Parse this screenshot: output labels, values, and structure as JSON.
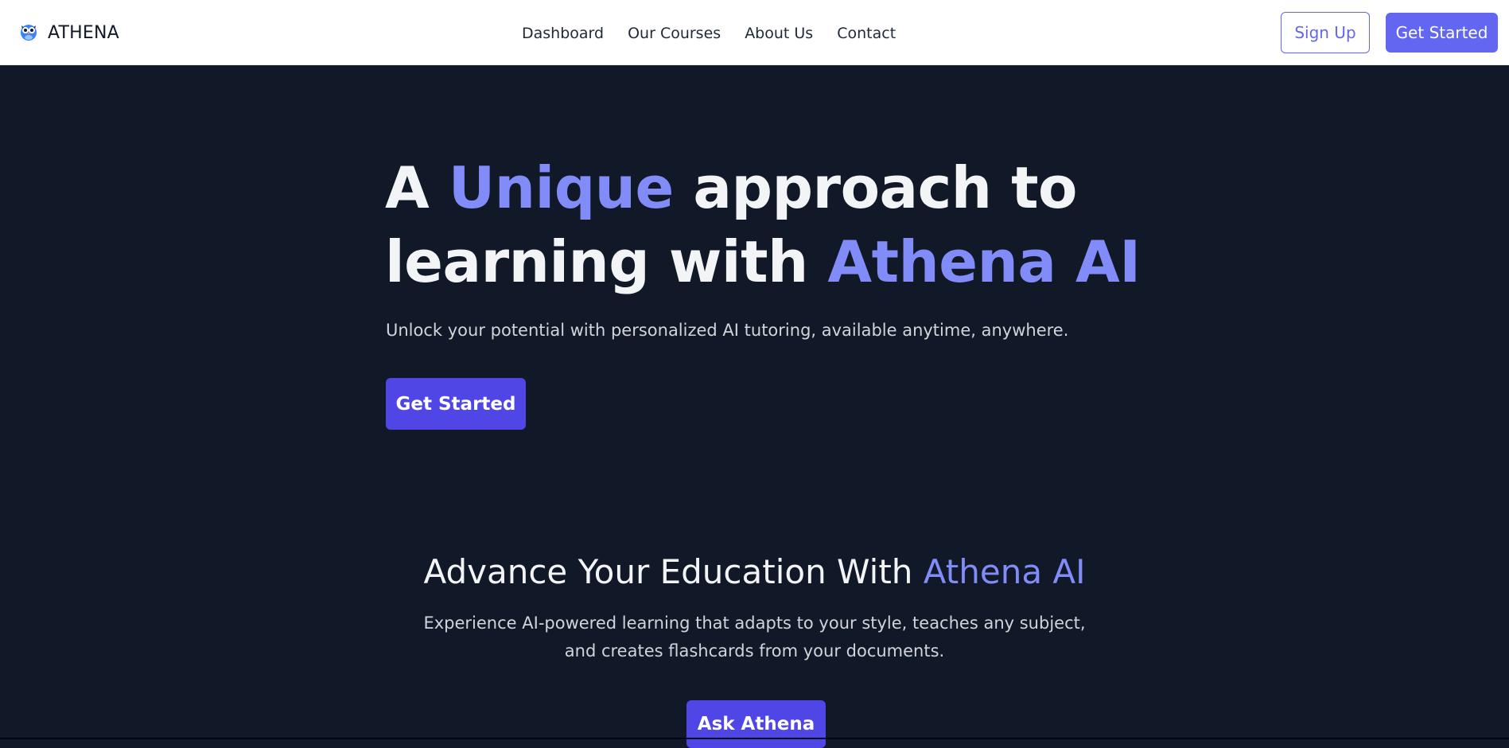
{
  "brand": {
    "name": "ATHENA",
    "logo_icon": "owl-icon"
  },
  "nav": {
    "links": [
      "Dashboard",
      "Our Courses",
      "About Us",
      "Contact"
    ],
    "signup_label": "Sign Up",
    "cta_label": "Get Started"
  },
  "hero": {
    "title_part1": "A ",
    "title_accent1": "Unique",
    "title_part2": " approach to",
    "title_part3": "learning with ",
    "title_accent2": "Athena AI",
    "subtitle": "Unlock your potential with personalized AI tutoring, available anytime, anywhere.",
    "cta_label": "Get Started"
  },
  "advance": {
    "title_part1": "Advance Your Education With ",
    "title_accent": "Athena AI",
    "text": "Experience AI-powered learning that adapts to your style, teaches any subject, and creates flashcards from your documents.",
    "cta_label": "Ask Athena"
  },
  "colors": {
    "background": "#111827",
    "accent": "#818cf8",
    "primary_button": "#4f46e5",
    "nav_button": "#6366f1"
  }
}
